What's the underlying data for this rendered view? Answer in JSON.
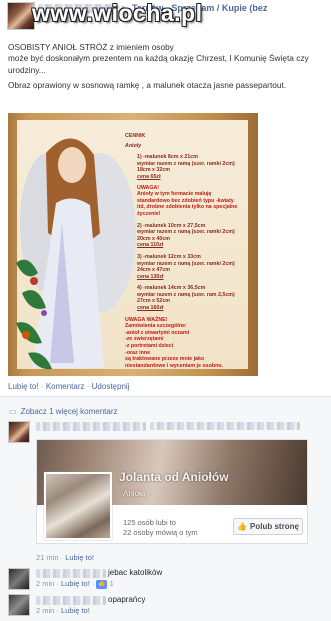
{
  "watermark": "www.wiocha.pl",
  "post": {
    "group": "Tarnów - Sprzedam / Kupie (bez",
    "text_lines": [
      "OSOBISTY ANIOŁ STRÓŻ z imieniem osoby",
      "może być doskonałym prezentem na każdą okazję Chrzest, I Komunię Święta czy urodziny...",
      "Obraz oprawiony w sosnową ramkę , a malunek otacza jasne passepartout."
    ]
  },
  "pricelist": {
    "title": "CENNIK",
    "subtitle": "Anioły",
    "items": [
      "1) -malunek 8cm x 21cm",
      "wymiar razem z ramą (szer. ramki 2cm)",
      "18cm x 32cm",
      "cena 65zł",
      "UWAGA!",
      "Anioły w tym formacie maluję",
      "standardowo bez zdobień typu -kwiaty",
      "itd, drobne zdobienia tylko na specjalne",
      "życzenie!",
      "2) -malunek 10cm x 27,5cm",
      "wymiar razem z ramą (szer. ramki 2cm)",
      "20cm x 40cm",
      "cena 110zł",
      "3) -malunek 12cm x 33cm",
      "wymiar razem z ramą (szer. ramki 2cm)",
      "24cm x 47cm",
      "cena 130zł",
      "4) -malunek 14cm x 36,5cm",
      "wymiar razem z ramą (szer. ram 2,5cm)",
      "27cm x 52cm",
      "cena 160zł",
      "UWAGA WAŻNE!",
      "Zamówienia szczególne:",
      "-anioł z otwartymi oczami",
      "-ze zwierzętami",
      "-z portretami dzieci",
      "-oraz inne",
      "są traktowane przeze mnie jako",
      "niestandardowe i wyceniam je osobno."
    ]
  },
  "actions": {
    "like": "Lubię to!",
    "comment": "Komentarz",
    "share": "Udostępnij"
  },
  "more_comments": "Zobacz 1 więcej komentarz",
  "page_card": {
    "name": "Jolanta od Aniołów",
    "category": "Anioła",
    "likes": "125 osób lubi to",
    "talking": "22 osoby mówią o tym",
    "like_button": "Polub stronę"
  },
  "comment1": {
    "time": "21 min",
    "like": "Lubię to!"
  },
  "comment2": {
    "text": "jebac katolików",
    "time": "2 min",
    "like": "Lubię to!",
    "count": "1"
  },
  "comment3": {
    "text": "opaprańcy",
    "time": "2 min",
    "like": "Lubię to!"
  }
}
